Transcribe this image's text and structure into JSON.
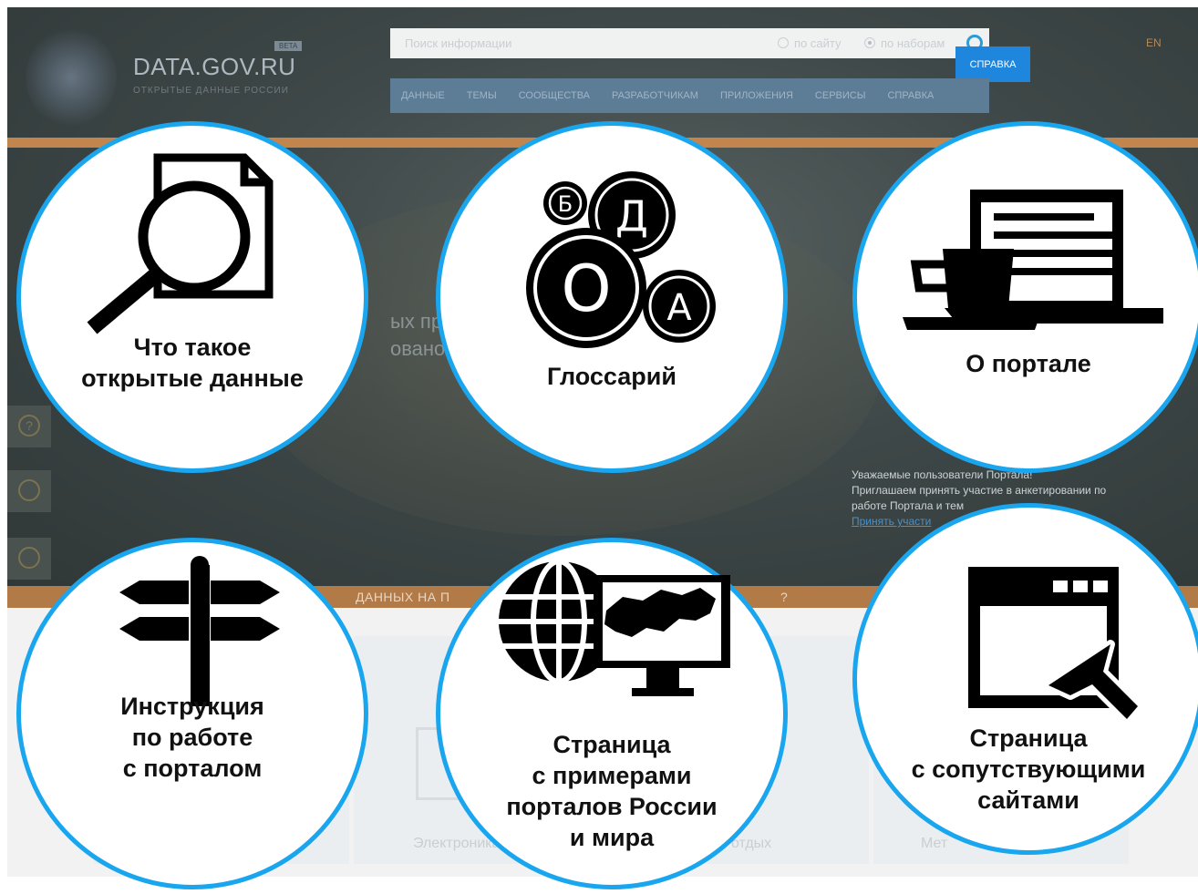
{
  "header": {
    "logo_text": "DATA.GOV.RU",
    "logo_subtitle": "ОТКРЫТЫЕ ДАННЫЕ РОССИИ",
    "beta_badge": "BETA",
    "search_placeholder": "Поиск информации",
    "search_option_site": "по сайту",
    "search_option_sets": "по наборам",
    "language": "EN",
    "help_button": "СПРАВКА"
  },
  "nav": {
    "items": [
      "ДАННЫЕ",
      "ТЕМЫ",
      "СООБЩЕСТВА",
      "РАЗРАБОТЧИКАМ",
      "ПРИЛОЖЕНИЯ",
      "СЕРВИСЫ",
      "СПРАВКА"
    ]
  },
  "hero": {
    "line1": "ых пр",
    "line2": "овано п"
  },
  "notice": {
    "line1": "Уважаемые пользователи Портала!",
    "line2": "Приглашаем принять участие в анкетировании по",
    "line3": "работе Портала и тем",
    "link": "Принять участи"
  },
  "strip": {
    "left": "ДАННЫХ НА П",
    "right": "?"
  },
  "bottom": {
    "card1": "Электроника",
    "card2": "отдых",
    "card3": "Мет"
  },
  "circles": [
    {
      "label": "Что такое\nоткрытые данные",
      "icon": "document-magnifier-icon"
    },
    {
      "label": "Глоссарий",
      "icon": "letter-bubbles-icon",
      "letters": [
        "Б",
        "Д",
        "О",
        "А"
      ]
    },
    {
      "label": "О портале",
      "icon": "laptop-coffee-icon"
    },
    {
      "label": "Инструкция\nпо работе\nс порталом",
      "icon": "signpost-icon"
    },
    {
      "label": "Страница\nс примерами\nпорталов России\nи мира",
      "icon": "globe-russia-monitor-icon"
    },
    {
      "label": "Страница\nс сопутствующими\nсайтами",
      "icon": "browser-cursor-icon"
    }
  ]
}
